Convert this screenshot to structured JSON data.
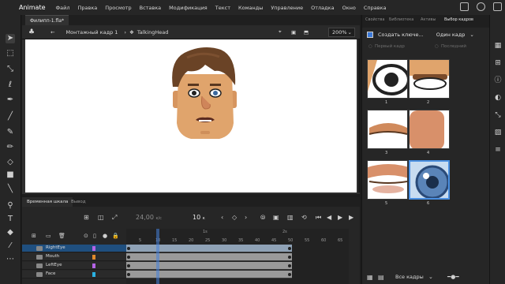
{
  "app": {
    "name": "Animate"
  },
  "menu": {
    "items": [
      "Файл",
      "Правка",
      "Просмотр",
      "Вставка",
      "Модификация",
      "Текст",
      "Команды",
      "Управление",
      "Отладка",
      "Окно",
      "Справка"
    ]
  },
  "document": {
    "tab": "Филипп-1.fla*"
  },
  "scene": {
    "scene_label": "Монтажный кадр 1",
    "symbol": "TalkingHead",
    "zoom": "200%"
  },
  "timeline": {
    "tabs": [
      "Временная шкала",
      "Вывод"
    ],
    "frame_rate": "24,00",
    "frame_rate_unit": "к/с",
    "current_frame": "10",
    "current_frame_suffix": "к",
    "ruler_labels": [
      "5",
      "10",
      "15",
      "20",
      "25",
      "30",
      "35",
      "40",
      "45",
      "50",
      "55",
      "60",
      "65"
    ],
    "ruler_seconds": [
      "1s",
      "2s"
    ],
    "layers": [
      {
        "name": "RightEye",
        "color": "#b464e6",
        "selected": true
      },
      {
        "name": "Mouth",
        "color": "#e08a2a",
        "selected": false
      },
      {
        "name": "LeftEye",
        "color": "#b464e6",
        "selected": false
      },
      {
        "name": "Face",
        "color": "#2ab0e0",
        "selected": false
      }
    ]
  },
  "frame_picker": {
    "tabs": [
      "Свойства",
      "Библиотека",
      "Активы",
      "Выбор кадров"
    ],
    "create_key_label": "Создать ключе...",
    "mode": "Один кадр",
    "first_frame": "Первый кадр",
    "last_frame": "Последний",
    "thumbnails": [
      "1",
      "2",
      "3",
      "4",
      "5",
      "6"
    ],
    "selected_thumb": "6",
    "bottom_label": "Все кадры"
  },
  "colors": {
    "accent": "#4a90e2",
    "selected_layer": "#1f4f7f",
    "panel_bg": "#262626"
  }
}
